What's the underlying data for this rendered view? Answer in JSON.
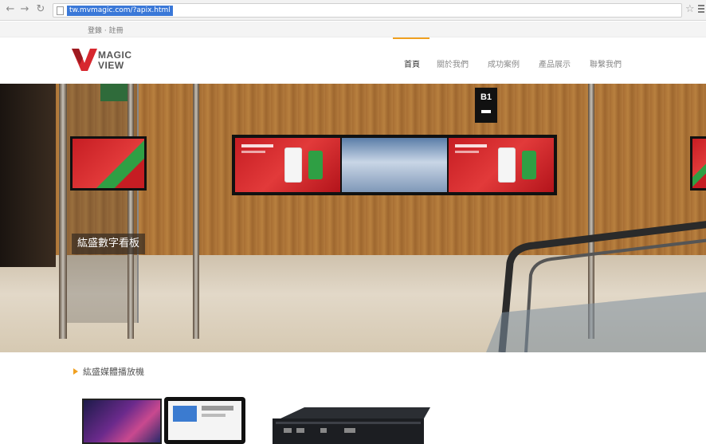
{
  "browser": {
    "back_icon": "back-arrow-icon",
    "forward_icon": "forward-arrow-icon",
    "reload_icon": "reload-icon",
    "url": "tw.mvmagic.com/?apix.html"
  },
  "utilbar": {
    "links": "登錄 · 註冊"
  },
  "header": {
    "logo_line1": "MAGIC",
    "logo_line2": "VIEW",
    "nav": [
      "首頁",
      "關於我們",
      "成功案例",
      "產品展示",
      "聯繫我們"
    ],
    "active_index": 0,
    "accent": "#f0a020"
  },
  "hero": {
    "caption": "紘盛數字看板",
    "sign_text": "B1"
  },
  "section": {
    "title": "紘盛媒體播放機"
  }
}
